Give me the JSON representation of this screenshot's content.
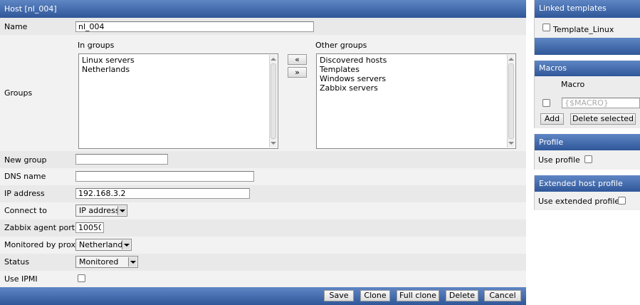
{
  "form": {
    "title": "Host  [nl_004]",
    "name_label": "Name",
    "name_value": "nl_004",
    "groups_label": "Groups",
    "in_groups_label": "In groups",
    "in_groups": [
      "Linux servers",
      "Netherlands"
    ],
    "other_groups_label": "Other groups",
    "other_groups": [
      "Discovered hosts",
      "Templates",
      "Windows servers",
      "Zabbix servers"
    ],
    "move_left": "«",
    "move_right": "»",
    "new_group_label": "New group",
    "new_group_value": "",
    "dns_label": "DNS name",
    "dns_value": "",
    "ip_label": "IP address",
    "ip_value": "192.168.3.2",
    "connect_label": "Connect to",
    "connect_value": "IP address",
    "port_label": "Zabbix agent port",
    "port_value": "10050",
    "proxy_label": "Monitored by proxy",
    "proxy_value": "Netherlands",
    "status_label": "Status",
    "status_value": "Monitored",
    "ipmi_label": "Use IPMI",
    "buttons": {
      "save": "Save",
      "clone": "Clone",
      "full_clone": "Full clone",
      "delete": "Delete",
      "cancel": "Cancel"
    }
  },
  "linked_templates": {
    "title": "Linked templates",
    "template_name": "Template_Linux"
  },
  "macros": {
    "title": "Macros",
    "column_macro": "Macro",
    "macro_placeholder": "{$MACRO}",
    "add": "Add",
    "delete_selected": "Delete selected"
  },
  "profile": {
    "title": "Profile",
    "use_profile": "Use profile"
  },
  "extended_profile": {
    "title": "Extended host profile",
    "use_extended": "Use extended profile"
  }
}
